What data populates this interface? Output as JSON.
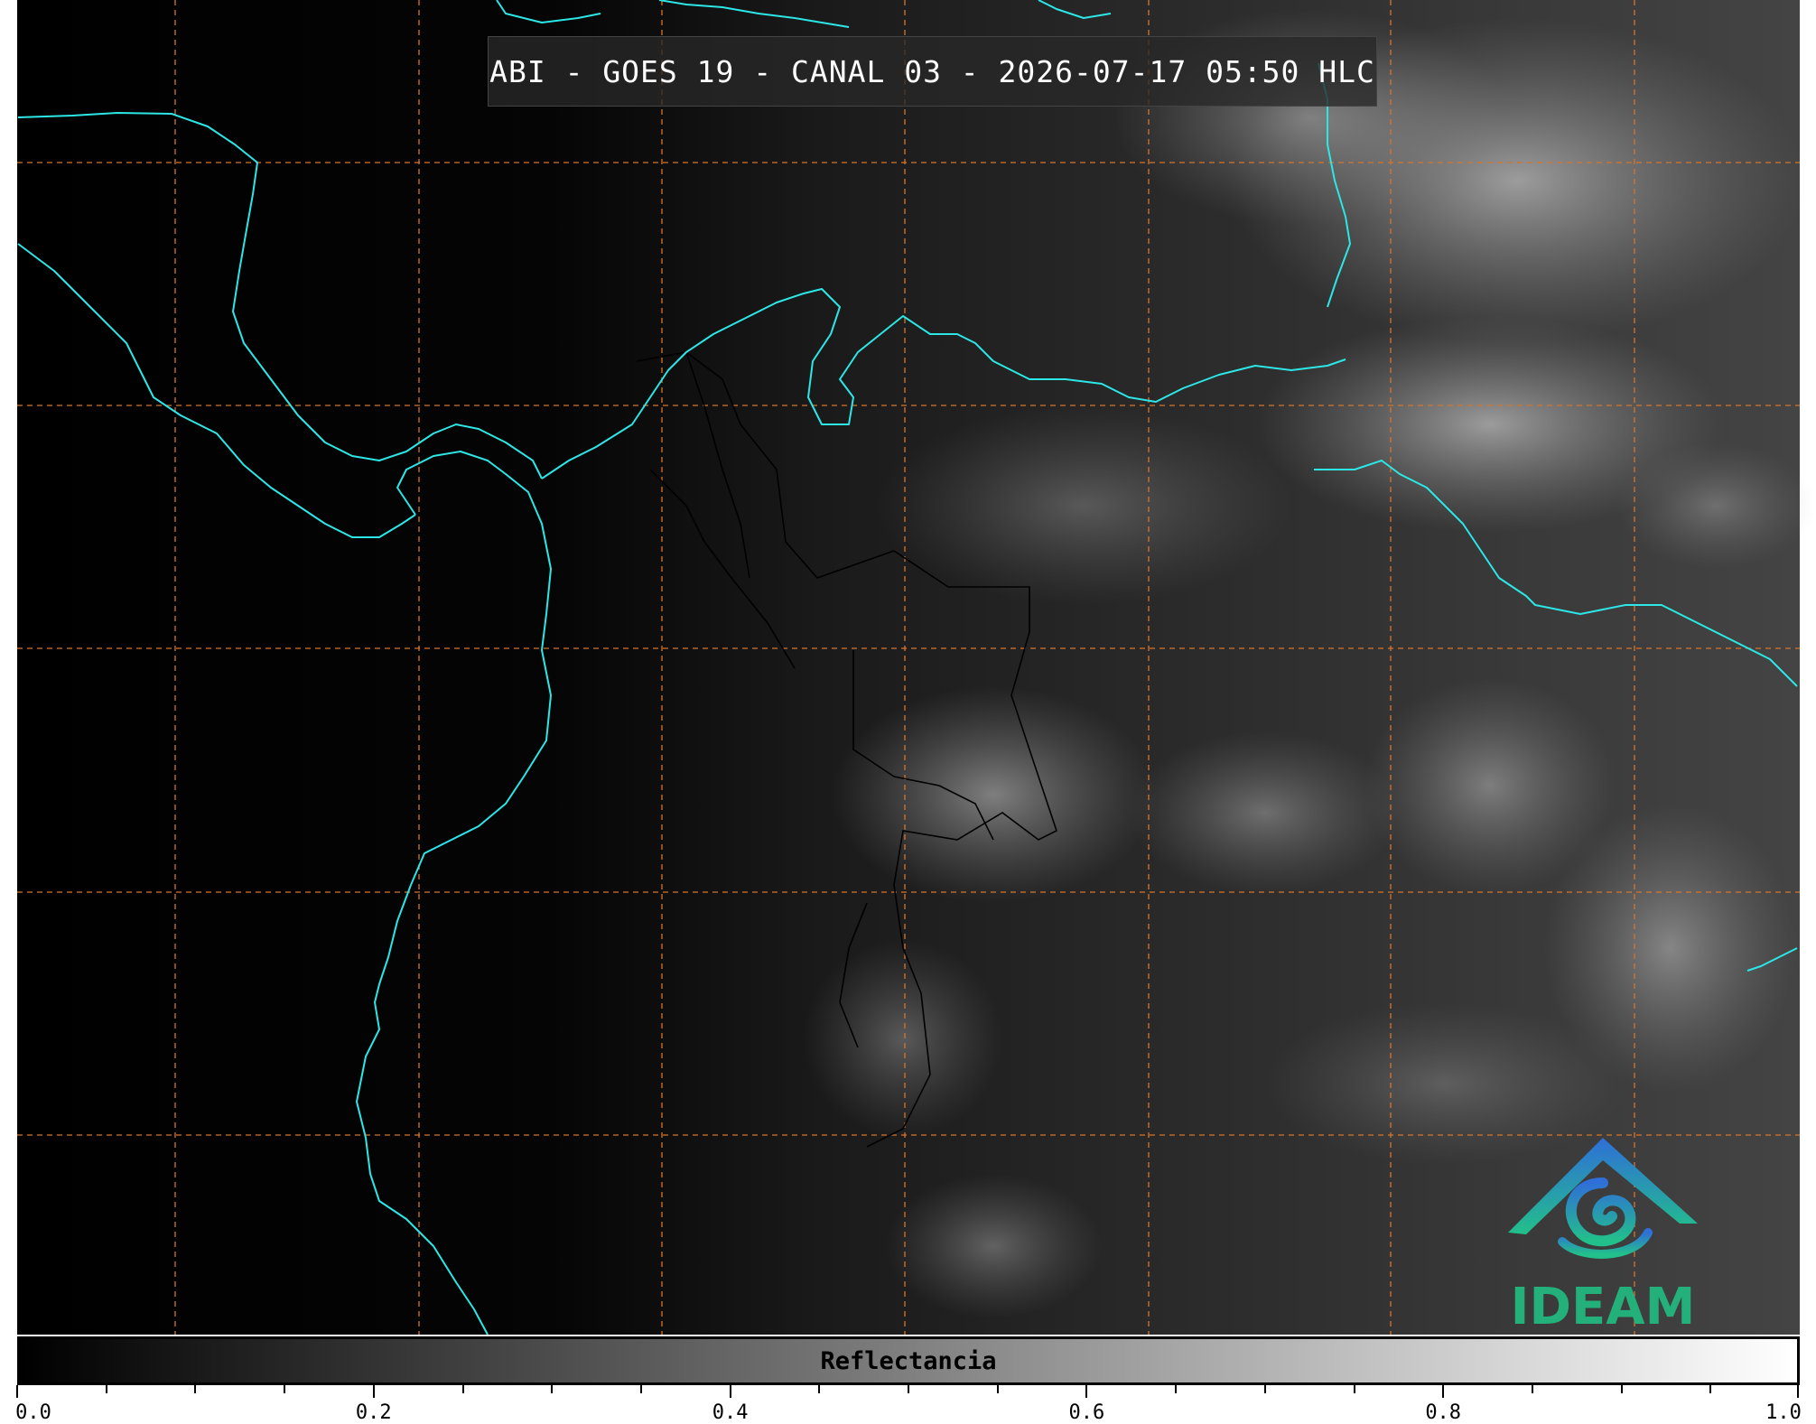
{
  "title": "ABI - GOES 19 - CANAL 03 - 2026-07-17 05:50 HLC",
  "colorbar": {
    "label": "Reflectancia",
    "ticks": [
      "0.0",
      "0.2",
      "0.4",
      "0.6",
      "0.8",
      "1.0"
    ],
    "gradient": [
      "#000000",
      "#ffffff"
    ]
  },
  "colors": {
    "coastline": "#2de6e6",
    "gridlines": "#d8742a",
    "borders": "#000000"
  },
  "logo": {
    "text": "IDEAM",
    "text_color": "#23b07a",
    "mark_gradient": [
      "#2f6fd8",
      "#22c08a"
    ]
  }
}
